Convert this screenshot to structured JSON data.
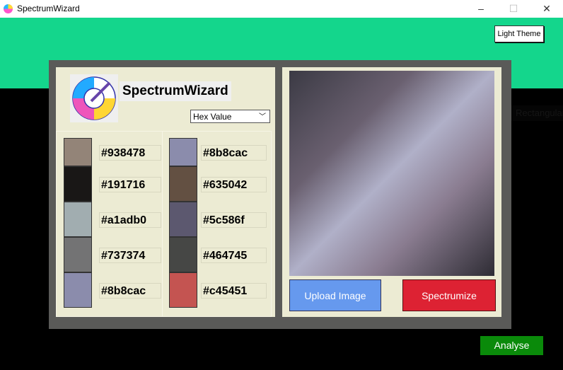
{
  "window": {
    "title": "SpectrumWizard",
    "minimize": "–",
    "maximize": "☐",
    "close": "✕"
  },
  "header": {
    "theme_button": "Light Theme"
  },
  "brand": {
    "name": "SpectrumWizard"
  },
  "format_select": {
    "value": "Hex Value"
  },
  "palette": {
    "left": [
      {
        "hex": "#938478"
      },
      {
        "hex": "#191716"
      },
      {
        "hex": "#a1adb0"
      },
      {
        "hex": "#737374"
      },
      {
        "hex": "#8b8cac"
      }
    ],
    "right": [
      {
        "hex": "#8b8cac"
      },
      {
        "hex": "#635042"
      },
      {
        "hex": "#5c586f"
      },
      {
        "hex": "#464745"
      },
      {
        "hex": "#c45451"
      }
    ]
  },
  "actions": {
    "upload": "Upload Image",
    "spectrumize": "Spectrumize",
    "analyse": "Analyse"
  },
  "hidden_option": "Rectangular",
  "colors": {
    "accent": "#14d68c",
    "upload": "#6699ee",
    "spectrumize": "#dd2233",
    "analyse": "#0a8a0a",
    "panel": "#ecebd3"
  }
}
